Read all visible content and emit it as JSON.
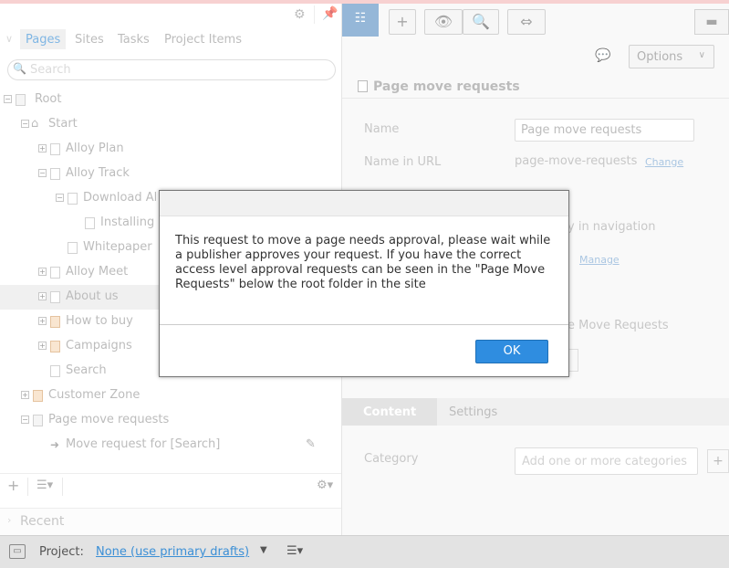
{
  "left_panel": {
    "tabs": [
      {
        "label": "Pages",
        "active": true
      },
      {
        "label": "Sites",
        "active": false
      },
      {
        "label": "Tasks",
        "active": false
      },
      {
        "label": "Project Items",
        "active": false
      }
    ],
    "search_placeholder": "Search",
    "tree": [
      {
        "label": "Root"
      },
      {
        "label": "Start"
      },
      {
        "label": "Alloy Plan"
      },
      {
        "label": "Alloy Track"
      },
      {
        "label": "Download Al"
      },
      {
        "label": "Installing"
      },
      {
        "label": "Whitepaper"
      },
      {
        "label": "Alloy Meet"
      },
      {
        "label": "About us"
      },
      {
        "label": "How to buy"
      },
      {
        "label": "Campaigns"
      },
      {
        "label": "Search"
      },
      {
        "label": "Customer Zone"
      },
      {
        "label": "Page move requests"
      },
      {
        "label": "Move request for [Search]"
      }
    ],
    "recent_label": "Recent"
  },
  "project_bar": {
    "label": "Project:",
    "value": "None (use primary drafts)"
  },
  "toolbar": {
    "options_label": "Options"
  },
  "page": {
    "title": "Page move requests",
    "fields": {
      "name_label": "Name",
      "name_value": "Page move requests",
      "url_label": "Name in URL",
      "url_value": "page-move-requests",
      "url_change": "Change",
      "nav_text": "y in navigation",
      "manage_text": "Manage",
      "pmr_text": "e Move Requests"
    },
    "content_tabs": [
      {
        "label": "Content",
        "active": true
      },
      {
        "label": "Settings",
        "active": false
      }
    ],
    "category_label": "Category",
    "category_placeholder": "Add one or more categories"
  },
  "dialog": {
    "message": "This request to move a page needs approval, please wait while a publisher approves your request. If you have the correct access level approval requests can be seen in the \"Page Move Requests\" below the root folder in the site",
    "ok_label": "OK"
  },
  "colors": {
    "accent": "#3b8fd6",
    "ok_button": "#2f8de0",
    "tree_toggle": "#5d91c3"
  }
}
